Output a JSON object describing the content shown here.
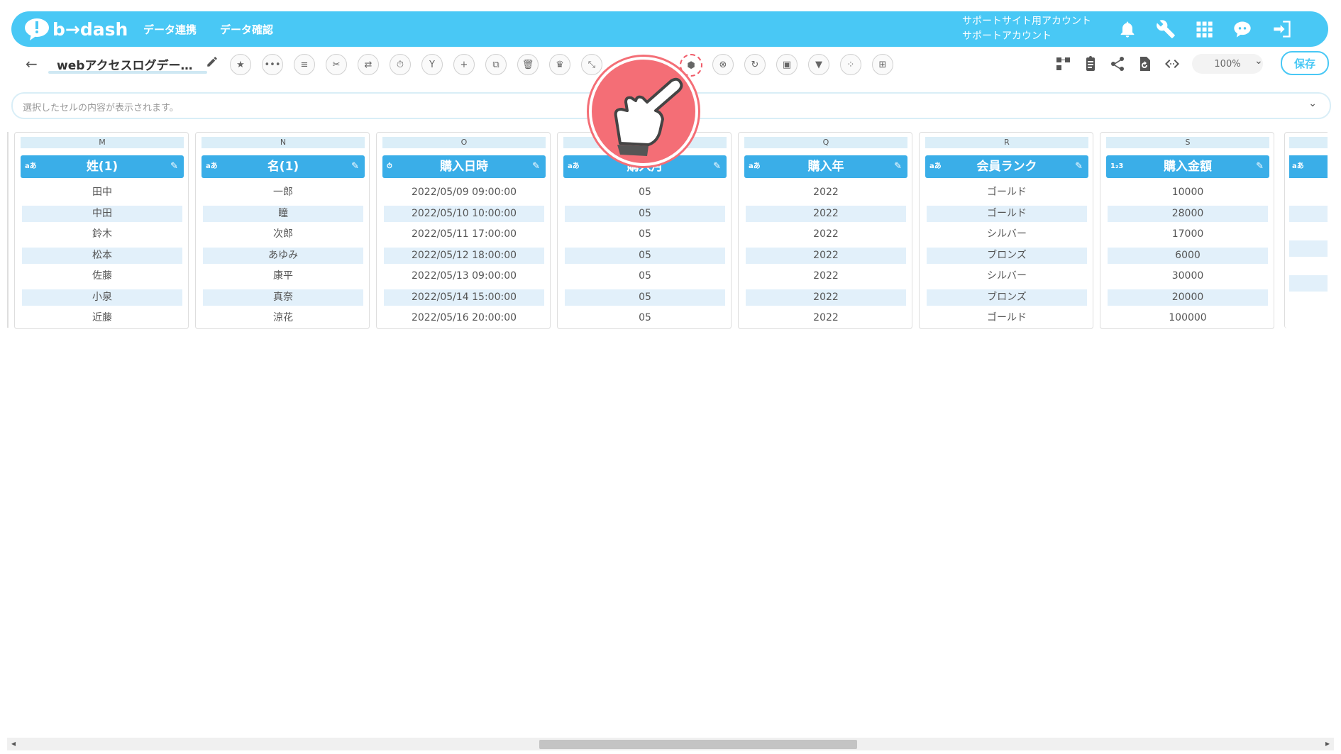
{
  "header": {
    "logo_text": "b→dash",
    "nav": [
      "データ連携",
      "データ確認"
    ],
    "account_line1": "サポートサイト用アカウント",
    "account_line2": "サポートアカウント"
  },
  "toolbar": {
    "back": "←",
    "title": "webアクセスログデー…",
    "zoom": "100%",
    "save_label": "保存"
  },
  "cellbar": {
    "placeholder": "選択したセルの内容が表示されます。"
  },
  "columns": [
    {
      "letter": "M",
      "type": "aあ",
      "name": "姓(1)",
      "cells": [
        "田中",
        "中田",
        "鈴木",
        "松本",
        "佐藤",
        "小泉",
        "近藤"
      ]
    },
    {
      "letter": "N",
      "type": "aあ",
      "name": "名(1)",
      "cells": [
        "一郎",
        "瞳",
        "次郎",
        "あゆみ",
        "康平",
        "真奈",
        "涼花"
      ]
    },
    {
      "letter": "O",
      "type": "⏱",
      "name": "購入日時",
      "cells": [
        "2022/05/09 09:00:00",
        "2022/05/10 10:00:00",
        "2022/05/11 17:00:00",
        "2022/05/12 18:00:00",
        "2022/05/13 09:00:00",
        "2022/05/14 15:00:00",
        "2022/05/16 20:00:00"
      ]
    },
    {
      "letter": "",
      "type": "aあ",
      "name": "購入月",
      "cells": [
        "05",
        "05",
        "05",
        "05",
        "05",
        "05",
        "05"
      ]
    },
    {
      "letter": "Q",
      "type": "aあ",
      "name": "購入年",
      "cells": [
        "2022",
        "2022",
        "2022",
        "2022",
        "2022",
        "2022",
        "2022"
      ]
    },
    {
      "letter": "R",
      "type": "aあ",
      "name": "会員ランク",
      "cells": [
        "ゴールド",
        "ゴールド",
        "シルバー",
        "ブロンズ",
        "シルバー",
        "ブロンズ",
        "ゴールド"
      ]
    },
    {
      "letter": "S",
      "type": "1₂3",
      "name": "購入金額",
      "cells": [
        "10000",
        "28000",
        "17000",
        "6000",
        "30000",
        "20000",
        "100000"
      ]
    }
  ],
  "partial_column": {
    "type": "aあ"
  },
  "colors": {
    "header_bg": "#49c8f5",
    "column_header": "#3aaee8",
    "pointer": "#f46e76"
  }
}
